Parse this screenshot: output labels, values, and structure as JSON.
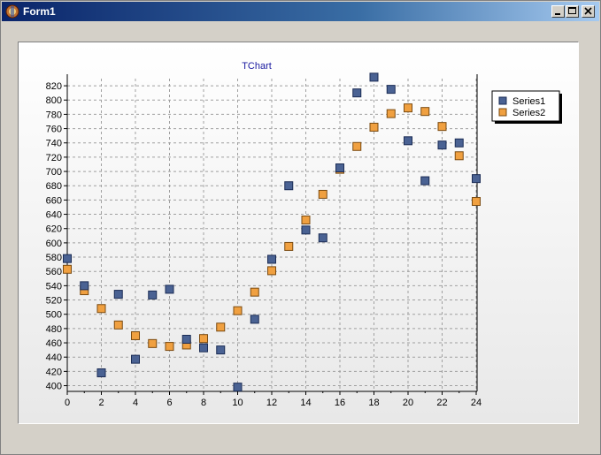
{
  "window": {
    "title": "Form1"
  },
  "colors": {
    "series1_fill": "#4a6293",
    "series1_stroke": "#1b2c55",
    "series2_fill": "#f0a040",
    "series2_stroke": "#7a4a10",
    "title": "#1a1aa0"
  },
  "icons": {
    "app": "delphi-app-icon",
    "minimize": "minimize-icon",
    "maximize": "maximize-icon",
    "close": "close-icon"
  },
  "chart_data": {
    "type": "scatter",
    "title": "TChart",
    "xlabel": "",
    "ylabel": "",
    "xlim": [
      0,
      24
    ],
    "ylim": [
      392,
      830
    ],
    "x_ticks": [
      0,
      2,
      4,
      6,
      8,
      10,
      12,
      14,
      16,
      18,
      20,
      22,
      24
    ],
    "y_ticks": [
      400,
      420,
      440,
      460,
      480,
      500,
      520,
      540,
      560,
      580,
      600,
      620,
      640,
      660,
      680,
      700,
      720,
      740,
      760,
      780,
      800,
      820
    ],
    "grid": true,
    "legend": {
      "placement": "top-right",
      "entries": [
        "Series1",
        "Series2"
      ]
    },
    "series": [
      {
        "name": "Series1",
        "x": [
          0,
          1,
          2,
          3,
          4,
          5,
          6,
          7,
          8,
          9,
          10,
          11,
          12,
          13,
          14,
          15,
          16,
          17,
          18,
          19,
          20,
          21,
          22,
          23,
          24
        ],
        "y": [
          578,
          540,
          418,
          528,
          437,
          527,
          535,
          465,
          453,
          450,
          398,
          493,
          577,
          680,
          618,
          607,
          705,
          810,
          832,
          815,
          743,
          687,
          737,
          740,
          690
        ]
      },
      {
        "name": "Series2",
        "x": [
          0,
          1,
          2,
          3,
          4,
          5,
          6,
          7,
          8,
          9,
          10,
          11,
          12,
          13,
          14,
          15,
          16,
          17,
          18,
          19,
          20,
          21,
          22,
          23,
          24
        ],
        "y": [
          563,
          533,
          508,
          485,
          470,
          459,
          455,
          457,
          466,
          482,
          505,
          531,
          561,
          595,
          632,
          668,
          703,
          735,
          762,
          781,
          789,
          784,
          763,
          722,
          658
        ]
      }
    ]
  }
}
